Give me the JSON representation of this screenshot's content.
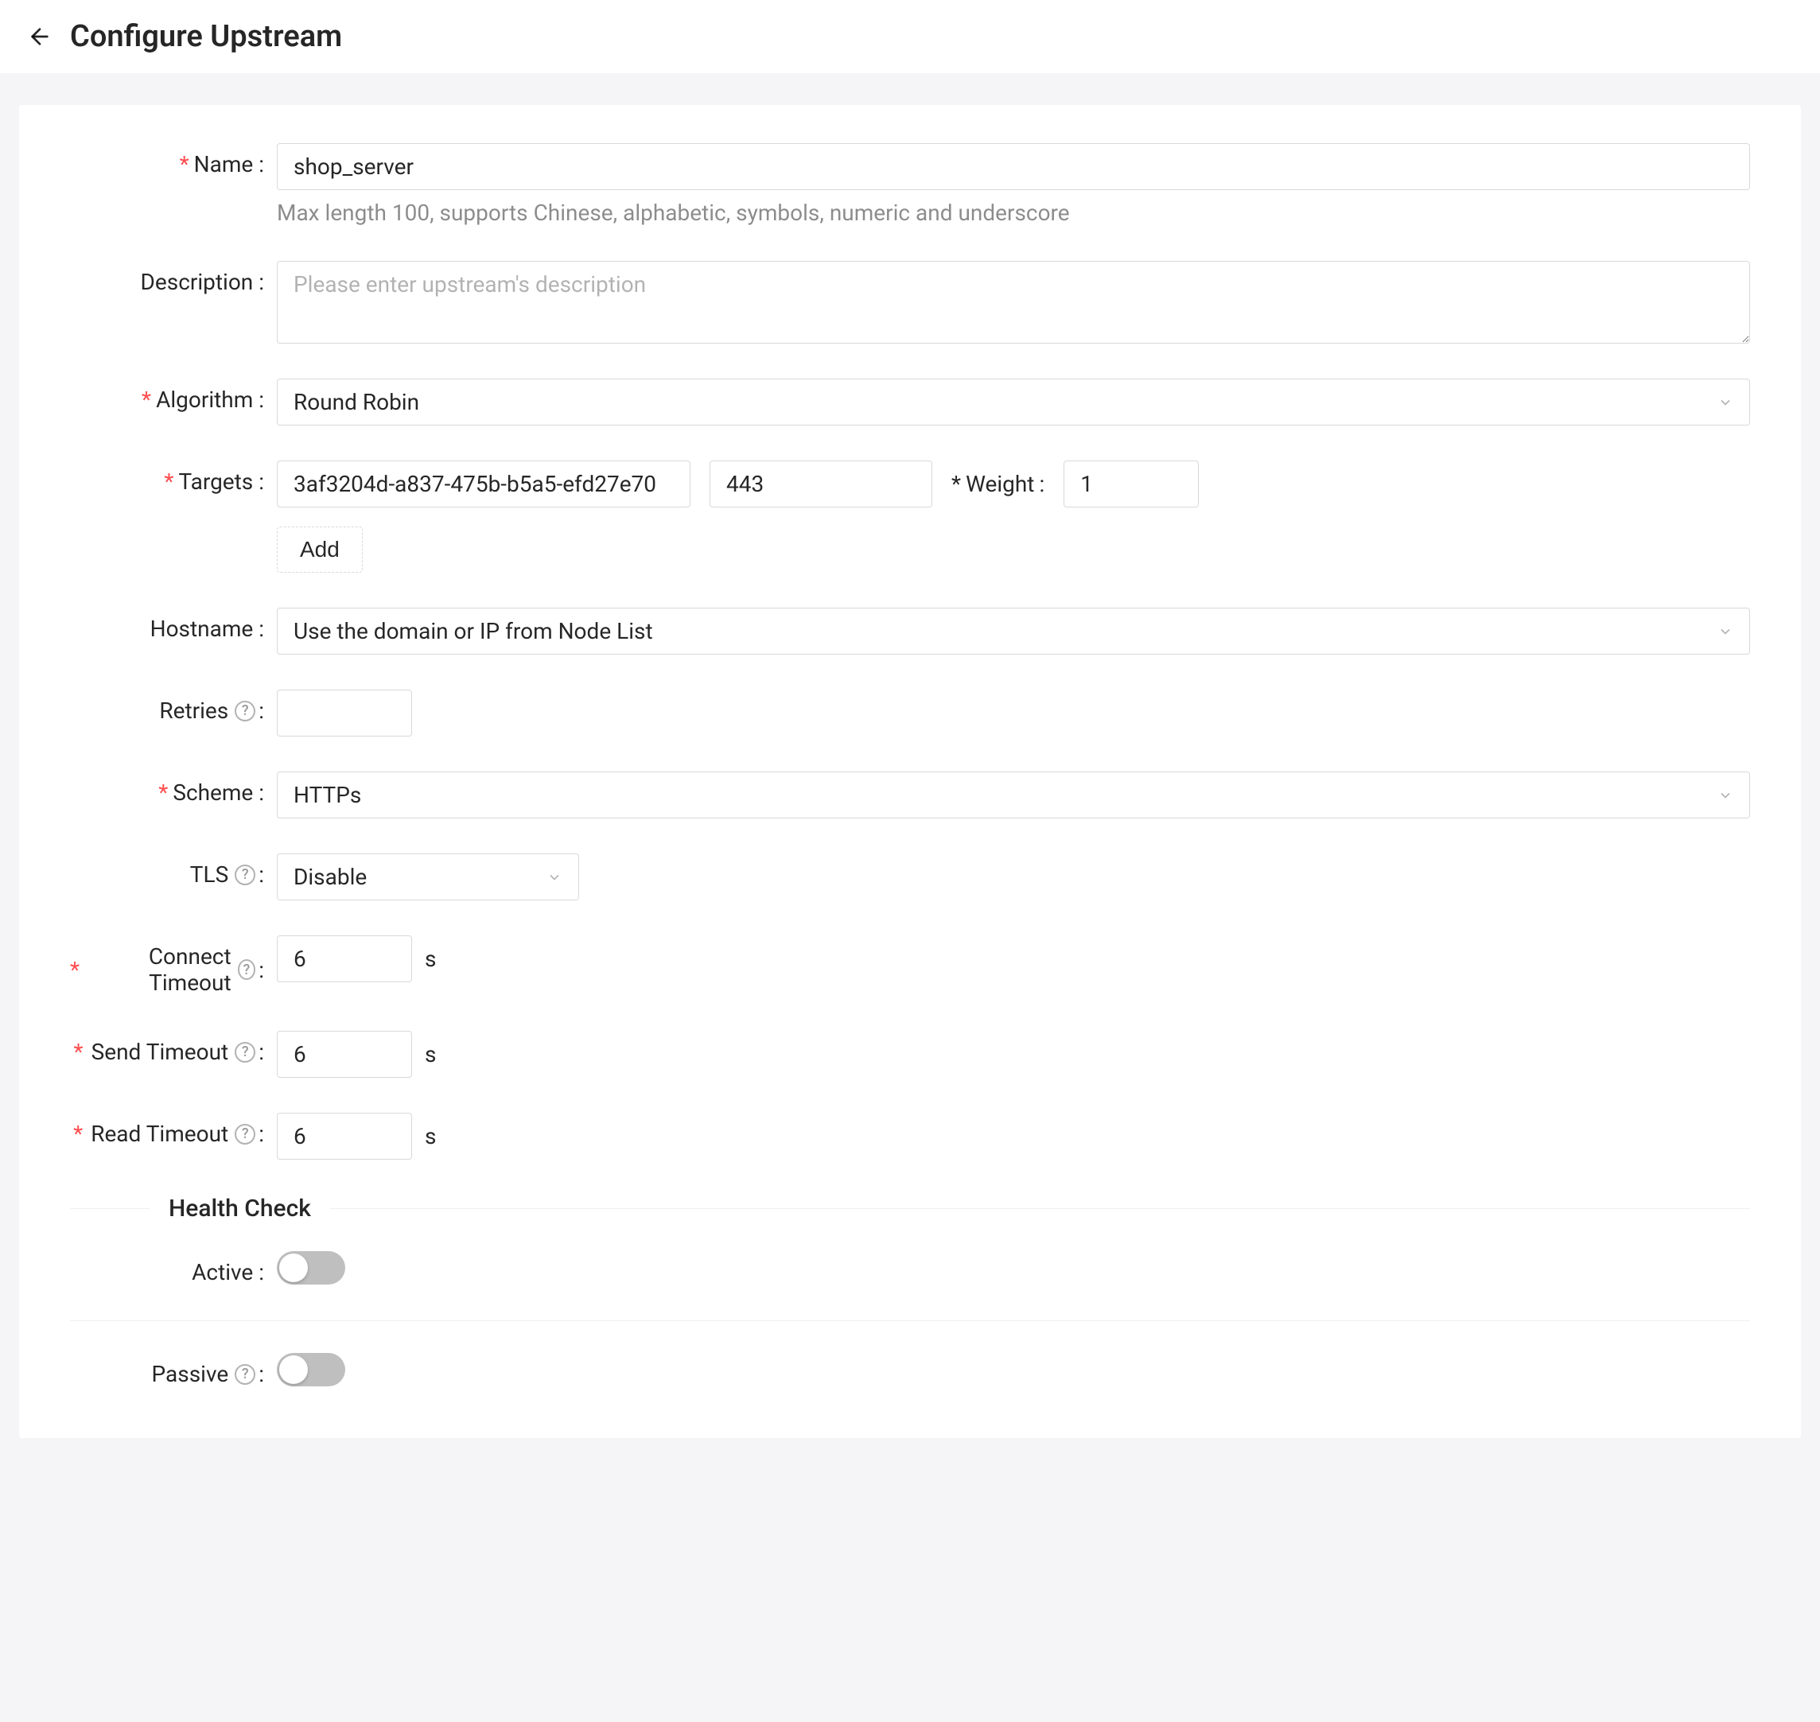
{
  "header": {
    "title": "Configure Upstream"
  },
  "form": {
    "name": {
      "label": "Name",
      "value": "shop_server",
      "hint": "Max length 100, supports Chinese, alphabetic, symbols, numeric and underscore"
    },
    "description": {
      "label": "Description",
      "placeholder": "Please enter upstream's description",
      "value": ""
    },
    "algorithm": {
      "label": "Algorithm",
      "value": "Round Robin"
    },
    "targets": {
      "label": "Targets",
      "host": "3af3204d-a837-475b-b5a5-efd27e70",
      "port": "443",
      "weight_label": "Weight",
      "weight": "1",
      "add_label": "Add"
    },
    "hostname": {
      "label": "Hostname",
      "value": "Use the domain or IP from Node List"
    },
    "retries": {
      "label": "Retries",
      "value": ""
    },
    "scheme": {
      "label": "Scheme",
      "value": "HTTPs"
    },
    "tls": {
      "label": "TLS",
      "value": "Disable"
    },
    "connect_timeout": {
      "label": "Connect Timeout",
      "value": "6",
      "unit": "s"
    },
    "send_timeout": {
      "label": "Send Timeout",
      "value": "6",
      "unit": "s"
    },
    "read_timeout": {
      "label": "Read Timeout",
      "value": "6",
      "unit": "s"
    },
    "health_check": {
      "title": "Health Check",
      "active_label": "Active",
      "active_on": false,
      "passive_label": "Passive",
      "passive_on": false
    }
  }
}
